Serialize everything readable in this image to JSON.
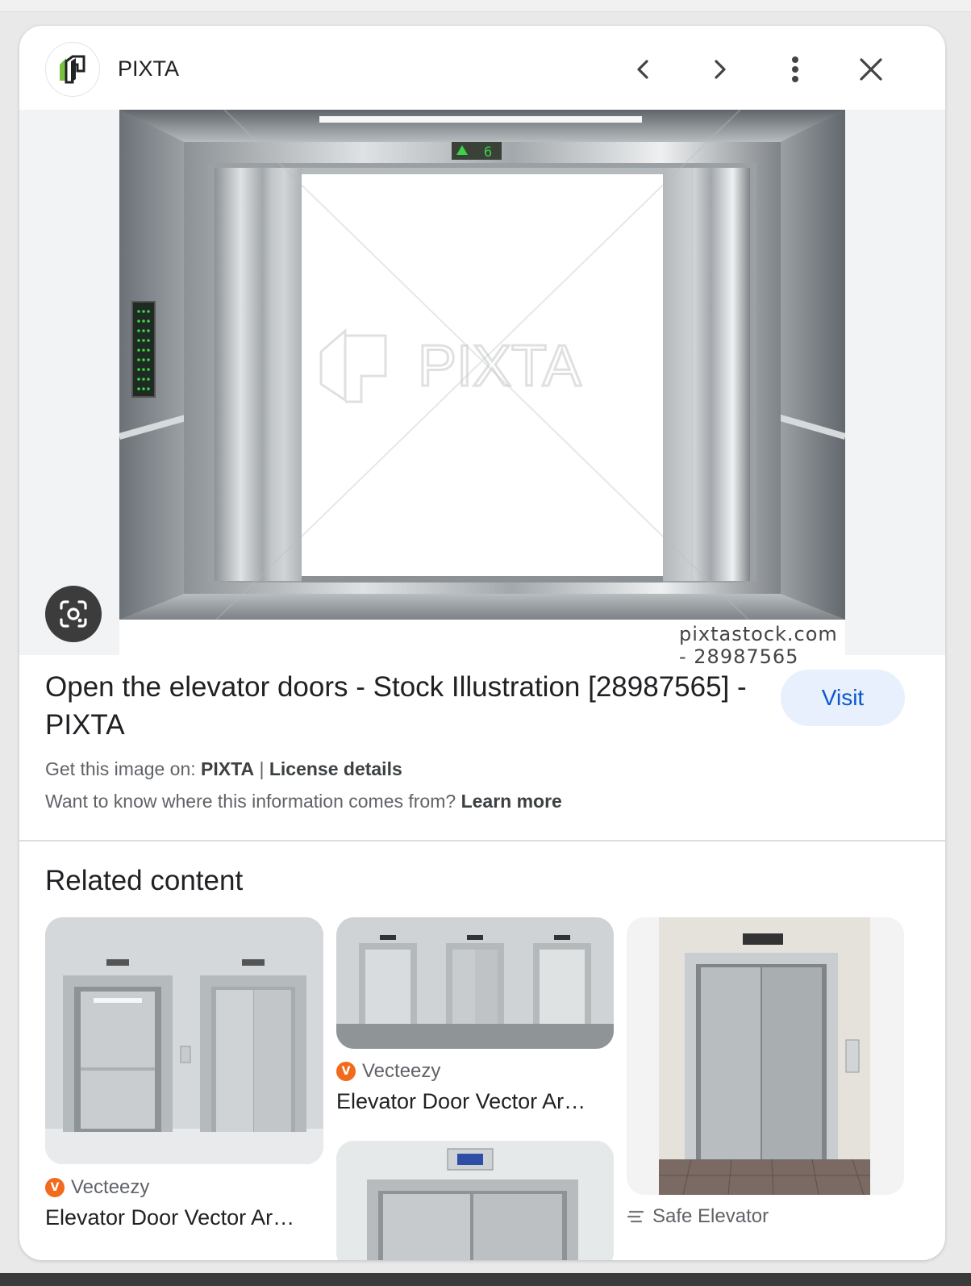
{
  "header": {
    "site_name": "PIXTA",
    "actions": [
      "previous",
      "next",
      "more-options",
      "close"
    ]
  },
  "hero": {
    "caption": "pixtastock.com - 28987565",
    "watermark": "PIXTA",
    "floor_display": "6"
  },
  "result": {
    "title": "Open the elevator doors - Stock Illustration [28987565] - PIXTA",
    "visit_label": "Visit",
    "get_image_prefix": "Get this image on: ",
    "get_image_source": "PIXTA",
    "separator": " | ",
    "license_label": "License details",
    "info_question": "Want to know where this information comes from? ",
    "learn_more": "Learn more"
  },
  "related": {
    "heading": "Related content",
    "items": [
      {
        "source": "Vecteezy",
        "title": "Elevator Door Vector Ar…"
      },
      {
        "source": "Vecteezy",
        "title": "Elevator Door Vector Ar…"
      },
      {
        "source": "Safe Elevator",
        "title": ""
      },
      {
        "source": "",
        "title": ""
      }
    ]
  },
  "colors": {
    "accent": "#0b57d0",
    "visit_bg": "#e8f0fe",
    "vecteezy": "#f26a1b"
  }
}
